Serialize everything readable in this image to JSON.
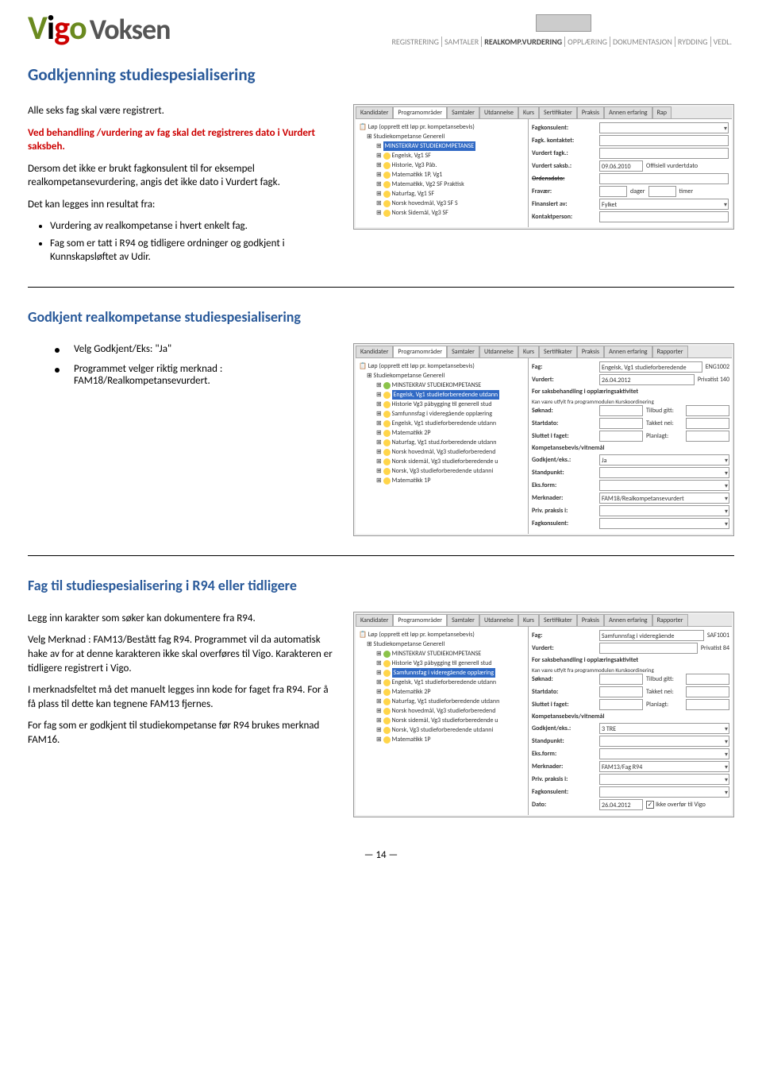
{
  "header": {
    "logo_parts": {
      "v": "V",
      "i": "i",
      "g": "g",
      "o": "o",
      "voksen": "Voksen"
    },
    "breadcrumb": [
      "REGISTRERING",
      "SAMTALER",
      "REALKOMP.VURDERING",
      "OPPLÆRING",
      "DOKUMENTASJON",
      "RYDDING",
      "VEDL."
    ],
    "active_crumb": "REALKOMP.VURDERING"
  },
  "section1": {
    "title": "Godkjenning studiespesialisering",
    "p1": "Alle seks fag skal være registrert.",
    "p2a": "Ved behandling /vurdering av fag skal det registreres dato i Vurdert saksbeh.",
    "p3": "Dersom det ikke er brukt fagkonsulent til for eksempel realkompetansevurdering, angis det ikke dato i Vurdert fagk.",
    "p4": "Det kan legges inn resultat fra:",
    "bullets": [
      "Vurdering av realkompetanse i hvert enkelt fag.",
      "Fag som er tatt i R94 og tidligere ordninger og godkjent i Kunnskapsløftet av Udir."
    ],
    "screenshot": {
      "tabs": [
        "Kandidater",
        "Programområder",
        "Samtaler",
        "Utdannelse",
        "Kurs",
        "Sertifikater",
        "Praksis",
        "Annen erfaring",
        "Rap"
      ],
      "active_tab": "Programområder",
      "tree_top": "Løp (opprett ett løp pr. kompetansebevis)",
      "tree_nodes": [
        {
          "t": "Studiekompetanse Generell",
          "cls": "indent1"
        },
        {
          "t": "MINSTEKRAV STUDIEKOMPETANSE",
          "cls": "indent2 selected-wrap",
          "sel": true
        },
        {
          "t": "Engelsk, Vg1 SF",
          "cls": "indent2 face"
        },
        {
          "t": "Historie, Vg3 Påb.",
          "cls": "indent2 face"
        },
        {
          "t": "Matematikk 1P, Vg1",
          "cls": "indent2 face"
        },
        {
          "t": "Matematikk, Vg2 SF Praktisk",
          "cls": "indent2 face"
        },
        {
          "t": "Naturfag, Vg1 SF",
          "cls": "indent2 face"
        },
        {
          "t": "Norsk hovedmål, Vg3 SF S",
          "cls": "indent2 face"
        },
        {
          "t": "Norsk Sidemål, Vg3 SF",
          "cls": "indent2 face"
        }
      ],
      "form": {
        "Fagkonsulent": "",
        "Fagk_kontaktet": "",
        "Vurdert_fagk": "",
        "Vurdert_saksb": "09.06.2010",
        "Vurdert_saksb_label": "Offisiell vurdertdato",
        "Ordensdato": "",
        "Fravaer_dager": "dager",
        "Fravaer_timer": "timer",
        "Finansiert_av": "Fylket",
        "Kontaktperson": ""
      }
    }
  },
  "section2": {
    "title": "Godkjent realkompetanse studiespesialisering",
    "b1": "Velg Godkjent/Eks: \"Ja\"",
    "b2": "Programmet velger riktig merknad : FAM18/Realkompetansevurdert.",
    "screenshot": {
      "tabs": [
        "Kandidater",
        "Programområder",
        "Samtaler",
        "Utdannelse",
        "Kurs",
        "Sertifikater",
        "Praksis",
        "Annen erfaring",
        "Rapporter"
      ],
      "active_tab": "Programområder",
      "tree_top": "Løp (opprett ett løp pr. kompetansebevis)",
      "tree_nodes": [
        {
          "t": "Studiekompetanse Generell",
          "cls": "indent1"
        },
        {
          "t": "MINSTEKRAV STUDIEKOMPETANSE",
          "cls": "indent2 face-green"
        },
        {
          "t": "Engelsk, Vg1 studieforberedende utdann",
          "cls": "indent2 face",
          "sel": true
        },
        {
          "t": "Historie Vg3 påbygging til generell stud",
          "cls": "indent2 face"
        },
        {
          "t": "Samfunnsfag i videregående opplæring",
          "cls": "indent2 face"
        },
        {
          "t": "Engelsk, Vg1 studieforberedende utdann",
          "cls": "indent2 face"
        },
        {
          "t": "Matematikk 2P",
          "cls": "indent2 face"
        },
        {
          "t": "Naturfag, Vg1 stud.forberedende utdann",
          "cls": "indent2 face"
        },
        {
          "t": "Norsk hovedmål, Vg3 studieforberedend",
          "cls": "indent2 face"
        },
        {
          "t": "Norsk sidemål, Vg3 studieforberedende u",
          "cls": "indent2 face"
        },
        {
          "t": "Norsk, Vg3 studieforberedende utdanni",
          "cls": "indent2 face"
        },
        {
          "t": "Matematikk 1P",
          "cls": "indent2 face"
        }
      ],
      "form": {
        "Fag": "Engelsk, Vg1 studieforberedende utdann",
        "Fag_code": "ENG1002",
        "Vurdert": "26.04.2012",
        "Privatist": "140",
        "Sub": "For saksbehandling i opplæringsaktivitet",
        "SubNote": "Kan være utfylt fra programmodulen Kurskoordinering",
        "Soknad": "",
        "Tilbud_gitt": "",
        "Startdato": "",
        "Takket_nei": "",
        "Sluttet_i_faget": "",
        "Planlagt": "",
        "Kompbevis": "Kompetansebevis/vitnemål",
        "Godkjent_eks": "Ja",
        "Standpunkt": "",
        "Eks_form": "",
        "Merknader": "FAM18/Realkompetansevurdert",
        "Priv_praksis": "",
        "Fagkonsulent": ""
      }
    }
  },
  "section3": {
    "title": "Fag til studiespesialisering i R94 eller tidligere",
    "p1": "Legg inn karakter som søker kan dokumentere fra R94.",
    "p2": "Velg Merknad : FAM13/Bestått fag  R94. Programmet vil da automatisk hake av for at denne karakteren ikke skal overføres til Vigo. Karakteren er tidligere registrert i Vigo.",
    "p3": "I merknadsfeltet må det manuelt legges inn kode for faget fra R94. For å få plass til dette kan tegnene FAM13 fjernes.",
    "p4": "For fag som er godkjent til studiekompetanse før R94 brukes merknad FAM16.",
    "screenshot": {
      "tabs": [
        "Kandidater",
        "Programområder",
        "Samtaler",
        "Utdannelse",
        "Kurs",
        "Sertifikater",
        "Praksis",
        "Annen erfaring",
        "Rapporter"
      ],
      "active_tab": "Programområder",
      "tree_top": "Løp (opprett ett løp pr. kompetansebevis)",
      "tree_nodes": [
        {
          "t": "Studiekompetanse Generell",
          "cls": "indent1"
        },
        {
          "t": "MINSTEKRAV STUDIEKOMPETANSE",
          "cls": "indent2 face-green"
        },
        {
          "t": "Historie Vg3 påbygging til generell stud",
          "cls": "indent2 face"
        },
        {
          "t": "Samfunnsfag i videregående opplæring",
          "cls": "indent2 face",
          "sel": true
        },
        {
          "t": "Engelsk, Vg1 studieforberedende utdann",
          "cls": "indent2 face"
        },
        {
          "t": "Matematikk 2P",
          "cls": "indent2 face"
        },
        {
          "t": "Naturfag, Vg1 studieforberedende utdann",
          "cls": "indent2 face"
        },
        {
          "t": "Norsk hovedmål, Vg3 studieforberedend",
          "cls": "indent2 face"
        },
        {
          "t": "Norsk sidemål, Vg3 studieforberedende u",
          "cls": "indent2 face"
        },
        {
          "t": "Norsk, Vg3 studieforberedende utdanni",
          "cls": "indent2 face"
        },
        {
          "t": "Matematikk 1P",
          "cls": "indent2 face"
        }
      ],
      "form": {
        "Fag": "Samfunnsfag i videregående opplæring",
        "Fag_code": "SAF1001",
        "Vurdert": "",
        "Privatist": "84",
        "Sub": "For saksbehandling i opplæringsaktivitet",
        "SubNote": "Kan være utfylt fra programmodulen Kurskoordinering",
        "Soknad": "",
        "Tilbud_gitt": "",
        "Startdato": "",
        "Takket_nei": "",
        "Sluttet_i_faget": "",
        "Planlagt": "",
        "Kompbevis": "Kompetansebevis/vitnemål",
        "Godkjent_eks": "3 TRE",
        "Standpunkt": "",
        "Eks_form": "",
        "Merknader": "FAM13/Fag R94",
        "Priv_praksis": "",
        "Fagkonsulent": "",
        "Dato": "26.04.2012",
        "Ikke_overfor": "Ikke overfør til Vigo"
      }
    }
  },
  "page_number": "— 14 —"
}
